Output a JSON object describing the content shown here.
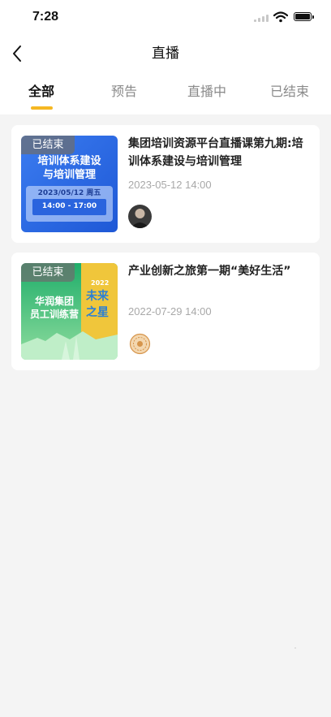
{
  "status_bar": {
    "time": "7:28"
  },
  "header": {
    "title": "直播"
  },
  "tabs": [
    {
      "label": "全部",
      "active": true
    },
    {
      "label": "预告",
      "active": false
    },
    {
      "label": "直播中",
      "active": false
    },
    {
      "label": "已结束",
      "active": false
    }
  ],
  "colors": {
    "accent": "#f5b722",
    "background": "#f4f4f4"
  },
  "items": [
    {
      "badge": "已结束",
      "title": "集团培训资源平台直播课第九期:培训体系建设与培训管理",
      "date": "2023-05-12 14:00",
      "thumb": {
        "line1": "培训体系建设",
        "line2": "与培训管理",
        "date": "2023/05/12 周五",
        "time": "14:00 - 17:00"
      }
    },
    {
      "badge": "已结束",
      "title": "产业创新之旅第一期“美好生活”",
      "date": "2022-07-29 14:00",
      "thumb": {
        "line1": "华润集团",
        "line2": "员工训练营",
        "tag": "2022",
        "side1": "未来",
        "side2": "之星"
      }
    }
  ]
}
